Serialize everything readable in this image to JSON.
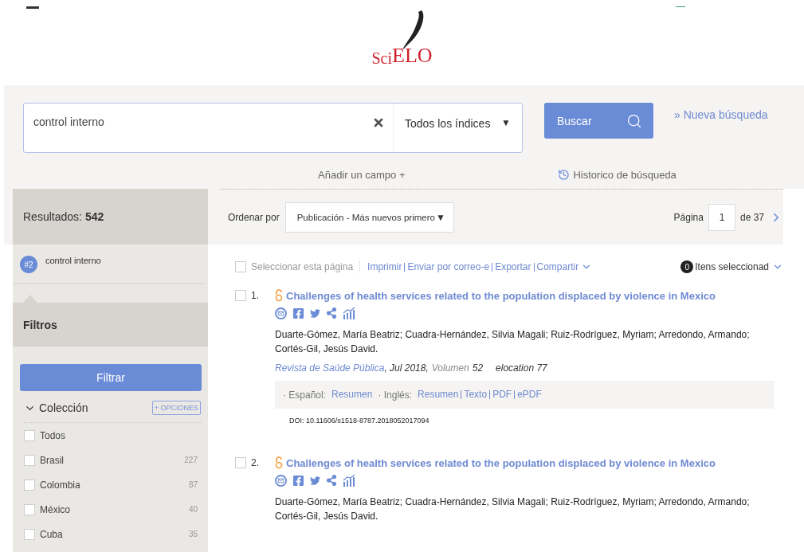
{
  "logo": {
    "part_1": "Sci",
    "part_2": "ELO"
  },
  "search": {
    "value": "control interno",
    "index": "Todos los índices",
    "arrow": "▼",
    "button": "Buscar",
    "new_search": "» Nueva búsqueda",
    "add_field": "Añadir un campo +",
    "history": "Historico de búsqueda"
  },
  "sidebar": {
    "results_label": "Resultados:",
    "results_count": "542",
    "history_item": {
      "badge": "#2",
      "query": "control interno"
    },
    "filters_title": "Filtros",
    "filter_button": "Filtrar",
    "collection": {
      "title": "Colección",
      "expanded": true,
      "options": "+ OPCIONES",
      "items": [
        {
          "name": "Todos",
          "checked": false
        },
        {
          "name": "Brasil",
          "count": "227",
          "checked": false
        },
        {
          "name": "Colombia",
          "count": "87",
          "checked": false
        },
        {
          "name": "México",
          "count": "40",
          "checked": false
        },
        {
          "name": "Cuba",
          "count": "35",
          "checked": false
        }
      ]
    }
  },
  "sort": {
    "label": "Ordenar por",
    "value": "Publicación - Más nuevos primero",
    "arrow": "▼",
    "page_label": "Página",
    "page": "1",
    "page_total": "de 37"
  },
  "actions": {
    "select_page": "Seleccionar esta página",
    "select_checked": false,
    "links": [
      "Imprimir",
      "Enviar por correo-e",
      "Exportar",
      "Compartir"
    ],
    "selected_count": "0",
    "selected_label": "Itens seleccionad"
  },
  "results": [
    {
      "number": "1.",
      "checked": false,
      "title": "Challenges of health services related to the population displaced by violence in Mexico",
      "authors": "Duarte-Gómez, María Beatriz; Cuadra-Hernández, Silvia Magali; Ruiz-Rodríguez, Myriam; Arredondo, Armando; Cortés-Gil, Jesús David.",
      "journal": "Revista de Saúde Pública",
      "date": ", Jul 2018,",
      "volume_label": "Volumen",
      "volume": "52",
      "elocation": "elocation 77",
      "languages": [
        {
          "label": "· Español:",
          "links": [
            "Resumen"
          ]
        },
        {
          "label": "· Inglés:",
          "links": [
            "Resumen",
            "Texto",
            "PDF",
            "ePDF"
          ]
        }
      ],
      "doi": "DOI: 10.11606/s1518-8787.2018052017094"
    },
    {
      "number": "2.",
      "checked": false,
      "title": "Challenges of health services related to the population displaced by violence in Mexico",
      "authors": "Duarte-Gómez, María Beatriz; Cuadra-Hernández, Silvia Magali; Ruiz-Rodríguez, Myriam; Arredondo, Armando; Cortés-Gil, Jesús David."
    }
  ]
}
